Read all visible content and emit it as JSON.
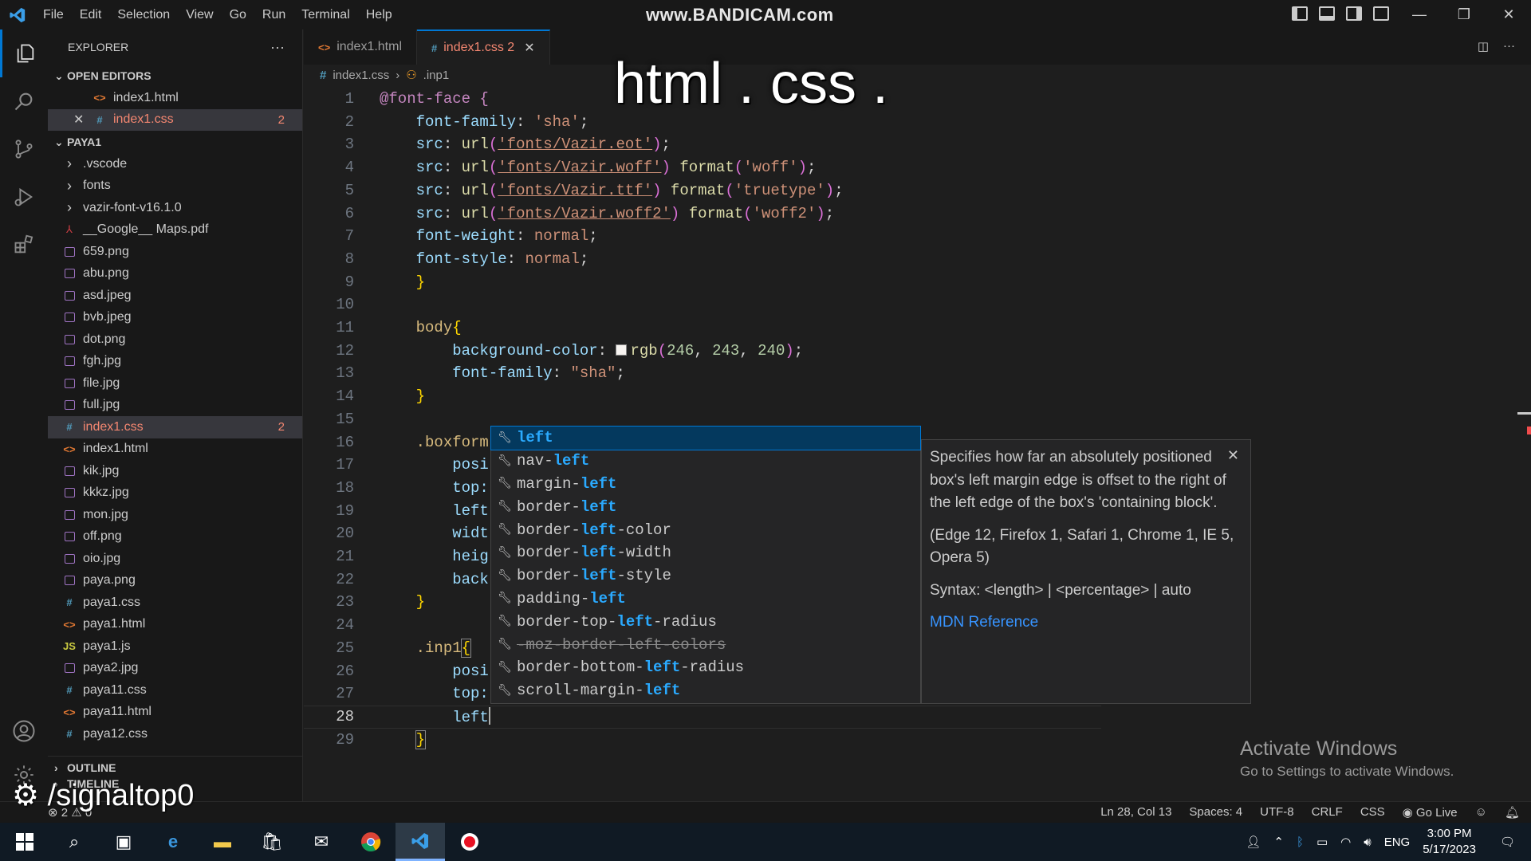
{
  "titlebar": {
    "menu": [
      "File",
      "Edit",
      "Selection",
      "View",
      "Go",
      "Run",
      "Terminal",
      "Help"
    ],
    "center_text": "www.BANDICAM.com",
    "window_controls": [
      "—",
      "❐",
      "✕"
    ]
  },
  "overlay_caption": "html . css .",
  "sidebar": {
    "title": "EXPLORER",
    "open_editors_label": "OPEN EDITORS",
    "open_editors": [
      {
        "name": "index1.html",
        "type": "html"
      },
      {
        "name": "index1.css",
        "type": "css",
        "badge": "2"
      }
    ],
    "folder_label": "PAYA1",
    "items": [
      {
        "name": ".vscode",
        "type": "folder"
      },
      {
        "name": "fonts",
        "type": "folder"
      },
      {
        "name": "vazir-font-v16.1.0",
        "type": "folder"
      },
      {
        "name": "__Google__ Maps.pdf",
        "type": "pdf"
      },
      {
        "name": "659.png",
        "type": "img"
      },
      {
        "name": "abu.png",
        "type": "img"
      },
      {
        "name": "asd.jpeg",
        "type": "img"
      },
      {
        "name": "bvb.jpeg",
        "type": "img"
      },
      {
        "name": "dot.png",
        "type": "img"
      },
      {
        "name": "fgh.jpg",
        "type": "img"
      },
      {
        "name": "file.jpg",
        "type": "img"
      },
      {
        "name": "full.jpg",
        "type": "img"
      },
      {
        "name": "index1.css",
        "type": "css",
        "badge": "2"
      },
      {
        "name": "index1.html",
        "type": "html"
      },
      {
        "name": "kik.jpg",
        "type": "img"
      },
      {
        "name": "kkkz.jpg",
        "type": "img"
      },
      {
        "name": "mon.jpg",
        "type": "img"
      },
      {
        "name": "off.png",
        "type": "img"
      },
      {
        "name": "oio.jpg",
        "type": "img"
      },
      {
        "name": "paya.png",
        "type": "img"
      },
      {
        "name": "paya1.css",
        "type": "css"
      },
      {
        "name": "paya1.html",
        "type": "html"
      },
      {
        "name": "paya1.js",
        "type": "js"
      },
      {
        "name": "paya2.jpg",
        "type": "img"
      },
      {
        "name": "paya11.css",
        "type": "css"
      },
      {
        "name": "paya11.html",
        "type": "html"
      },
      {
        "name": "paya12.css",
        "type": "css"
      }
    ],
    "outline_label": "OUTLINE",
    "timeline_label": "TIMELINE"
  },
  "tabs": [
    {
      "label": "index1.html",
      "type": "html",
      "active": false
    },
    {
      "label": "index1.css 2",
      "type": "css",
      "active": true
    }
  ],
  "breadcrumb": {
    "file": "index1.css",
    "symbol": ".inp1"
  },
  "editor": {
    "current_line": 28,
    "lines": [
      {
        "n": "1"
      },
      {
        "n": "2"
      },
      {
        "n": "3"
      },
      {
        "n": "4"
      },
      {
        "n": "5"
      },
      {
        "n": "6"
      },
      {
        "n": "7"
      },
      {
        "n": "8"
      },
      {
        "n": "9"
      },
      {
        "n": "10"
      },
      {
        "n": "11"
      },
      {
        "n": "12"
      },
      {
        "n": "13"
      },
      {
        "n": "14"
      },
      {
        "n": "15"
      },
      {
        "n": "16"
      },
      {
        "n": "17"
      },
      {
        "n": "18"
      },
      {
        "n": "19"
      },
      {
        "n": "20"
      },
      {
        "n": "21"
      },
      {
        "n": "22"
      },
      {
        "n": "23"
      },
      {
        "n": "24"
      },
      {
        "n": "25"
      },
      {
        "n": "26"
      },
      {
        "n": "27"
      },
      {
        "n": "28"
      },
      {
        "n": "29"
      }
    ],
    "code": {
      "l1": "@font-face {",
      "l2_prop": "font-family",
      "l2_val": "'sha'",
      "l3_url": "'fonts/Vazir.eot'",
      "l4_url": "'fonts/Vazir.woff'",
      "l4_fmt": "'woff'",
      "l5_url": "'fonts/Vazir.ttf'",
      "l5_fmt": "'truetype'",
      "l6_url": "'fonts/Vazir.woff2'",
      "l6_fmt": "'woff2'",
      "l7_prop": "font-weight",
      "l7_val": "normal",
      "l8_prop": "font-style",
      "l8_val": "normal",
      "l11_sel": "body",
      "l12_prop": "background-color",
      "l12_r": "246",
      "l12_g": "243",
      "l12_b": "240",
      "l13_prop": "font-family",
      "l13_val": "\"sha\"",
      "l16_sel": ".boxform",
      "l17": "posi",
      "l18": "top:",
      "l19": "left",
      "l20": "widt",
      "l21": "heig",
      "l22": "back",
      "l25_sel": ".inp1",
      "l26": "posi",
      "l27": "top:",
      "l28": "left"
    }
  },
  "suggest": {
    "items": [
      {
        "pre": "",
        "hl": "left",
        "post": "",
        "focused": true
      },
      {
        "pre": "nav-",
        "hl": "left",
        "post": ""
      },
      {
        "pre": "margin-",
        "hl": "left",
        "post": ""
      },
      {
        "pre": "border-",
        "hl": "left",
        "post": ""
      },
      {
        "pre": "border-",
        "hl": "left",
        "post": "-color"
      },
      {
        "pre": "border-",
        "hl": "left",
        "post": "-width"
      },
      {
        "pre": "border-",
        "hl": "left",
        "post": "-style"
      },
      {
        "pre": "padding-",
        "hl": "left",
        "post": ""
      },
      {
        "pre": "border-top-",
        "hl": "left",
        "post": "-radius"
      },
      {
        "pre": "-moz-border-left-colors",
        "hl": "",
        "post": "",
        "deprecated": true
      },
      {
        "pre": "border-bottom-",
        "hl": "left",
        "post": "-radius"
      },
      {
        "pre": "scroll-margin-",
        "hl": "left",
        "post": ""
      }
    ],
    "details": {
      "description": "Specifies how far an absolutely positioned box's left margin edge is offset to the right of the left edge of the box's 'containing block'.",
      "browsers": "(Edge 12, Firefox 1, Safari 1, Chrome 1, IE 5, Opera 5)",
      "syntax": "Syntax: <length> | <percentage> | auto",
      "link": "MDN Reference"
    }
  },
  "statusbar": {
    "left": "⊗ 2 ⚠ 0",
    "position": "Ln 28, Col 13",
    "spaces": "Spaces: 4",
    "encoding": "UTF-8",
    "eol": "CRLF",
    "language": "CSS",
    "golive": "Go Live"
  },
  "watermark_signal": "/signaltop0",
  "activate": {
    "title": "Activate Windows",
    "subtitle": "Go to Settings to activate Windows."
  },
  "taskbar": {
    "lang": "ENG",
    "time": "3:00 PM",
    "date": "5/17/2023"
  },
  "colors": {
    "accent": "#0078d4",
    "error": "#f48771",
    "link": "#3794ff"
  }
}
